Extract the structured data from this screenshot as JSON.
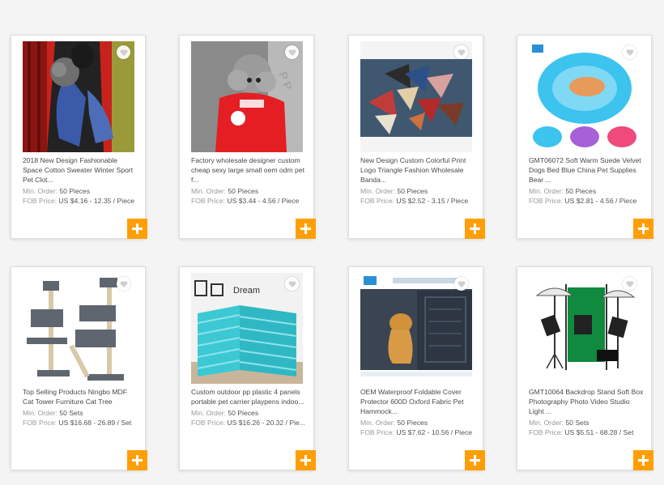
{
  "colors": {
    "accent": "#ff9f05",
    "page_bg": "#f4f4f5",
    "text": "#4a4a4a",
    "muted": "#999999"
  },
  "labels": {
    "min_order": "Min. Order:",
    "fob_price": "FOB Price:"
  },
  "products": [
    {
      "title": "2018 New Design Fashionable Space Cotton Sweater Winter Sport Pet Clot...",
      "min_order": "50 Pieces",
      "fob_price": "US $4.16 - 12.35 / Piece",
      "image_icon": "dog-sweater-photo"
    },
    {
      "title": "Factory wholesale designer custom cheap sexy large small oem odm pet f...",
      "min_order": "50 Pieces",
      "fob_price": "US $3.44 - 4.56 / Piece",
      "image_icon": "poodle-shirt-photo"
    },
    {
      "title": "New Design Custom Colorful Print Logo Triangle Fashion Wholesale Banda...",
      "min_order": "50 Pieces",
      "fob_price": "US $2.52 - 3.15 / Piece",
      "image_icon": "bandanas-photo"
    },
    {
      "title": "GMT06072 Soft Warm Suede Velvet Dogs Bed Blue China Pet Supplies Bear ...",
      "min_order": "50 Pieces",
      "fob_price": "US $2.81 - 4.56 / Piece",
      "image_icon": "pet-bed-photo"
    },
    {
      "title": "Top Selling Products Ningbo MDF Cat Tower Furniture Cat Tree",
      "min_order": "50 Sets",
      "fob_price": "US $16.68 - 26.89 / Set",
      "image_icon": "cat-tree-photo"
    },
    {
      "title": "Custom outdoor pp plastic 4 panels portable pet carrier playpens indoo...",
      "min_order": "50 Pieces",
      "fob_price": "US $16.26 - 20.32 / Pie...",
      "image_icon": "playpen-photo"
    },
    {
      "title": "OEM Waterproof Foldable Cover Protector 600D Oxford Fabric Pet Hammock...",
      "min_order": "50 Pieces",
      "fob_price": "US $7.62 - 10.56 / Piece",
      "image_icon": "car-seat-cover-photo"
    },
    {
      "title": "GMT10064 Backdrop Stand Soft Box Photography Photo Video Studio Light ...",
      "min_order": "50 Sets",
      "fob_price": "US $5.51 - 68.28 / Set",
      "image_icon": "studio-light-photo"
    }
  ]
}
